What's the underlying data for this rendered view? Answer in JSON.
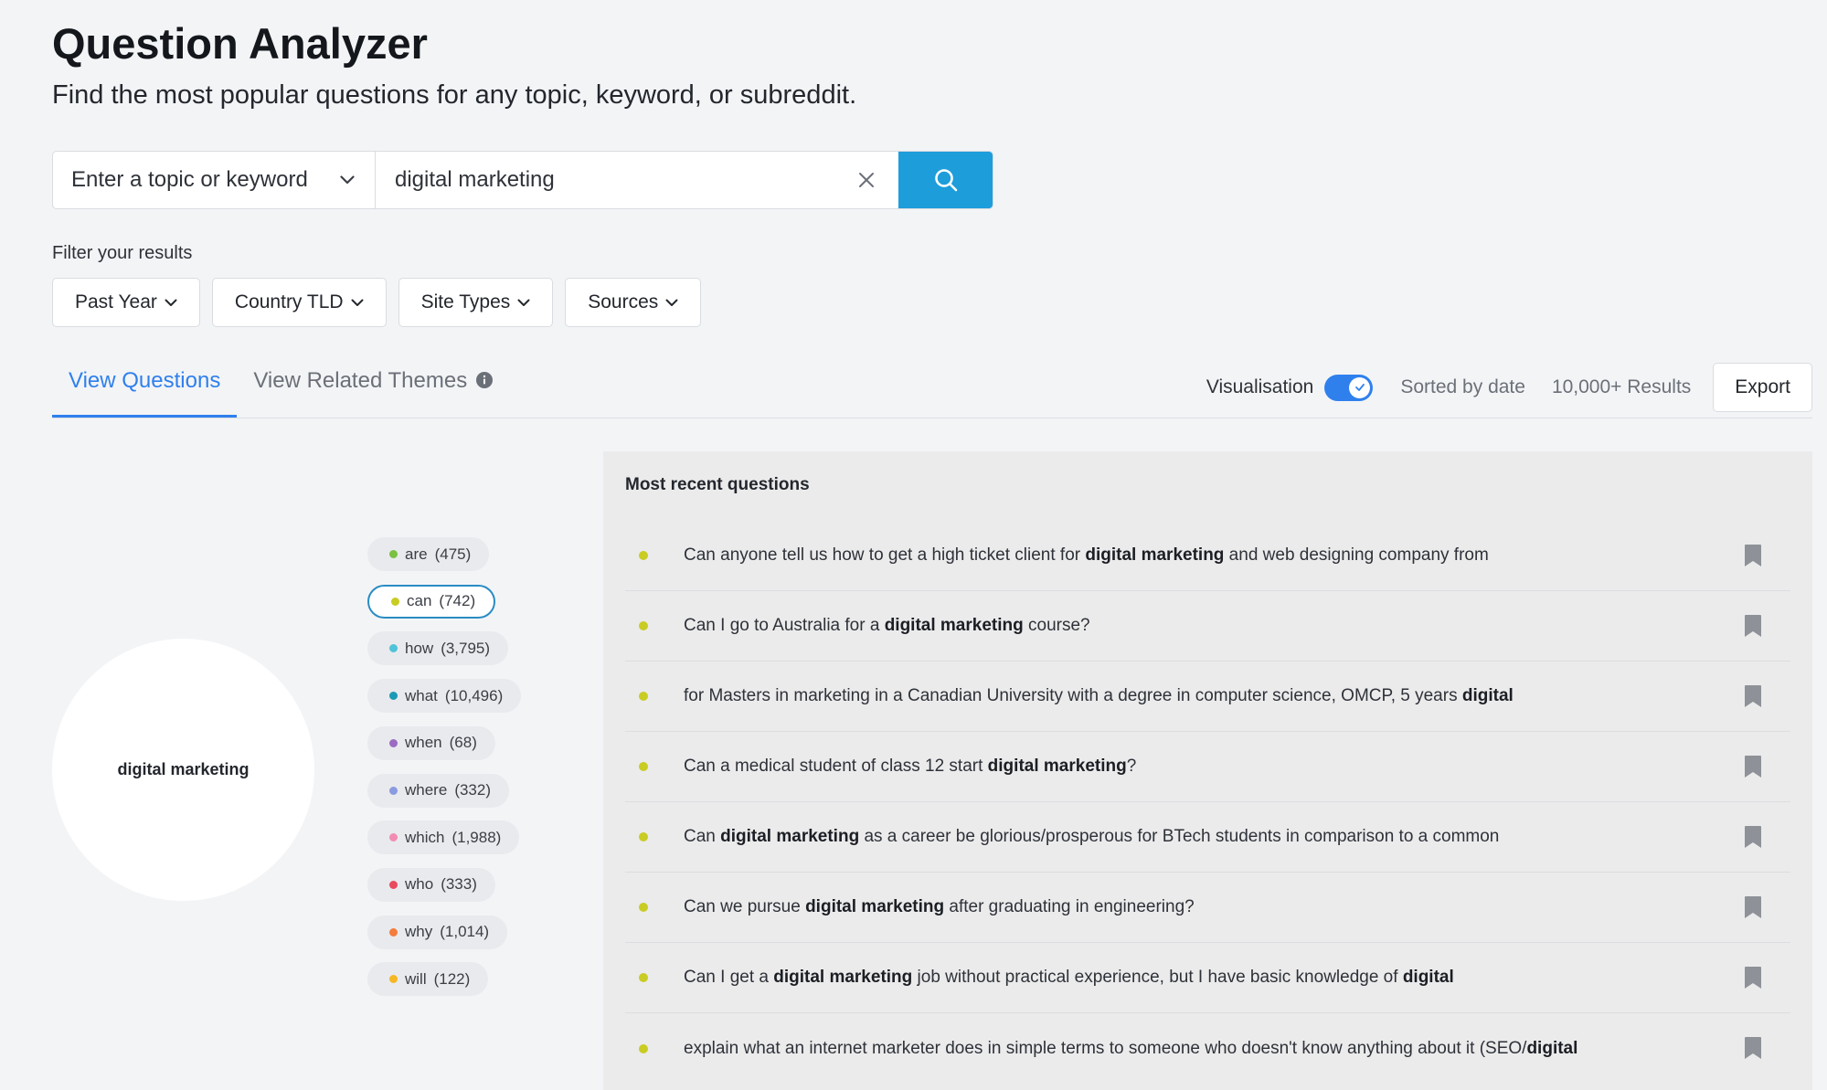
{
  "header": {
    "title": "Question Analyzer",
    "subtitle": "Find the most popular questions for any topic, keyword, or subreddit."
  },
  "search": {
    "topic_select_label": "Enter a topic or keyword",
    "query": "digital marketing"
  },
  "filters": {
    "label": "Filter your results",
    "buttons": [
      "Past Year",
      "Country TLD",
      "Site Types",
      "Sources"
    ]
  },
  "tabs": [
    {
      "label": "View Questions",
      "active": true
    },
    {
      "label": "View Related Themes",
      "active": false
    }
  ],
  "toolbar": {
    "visualisation_label": "Visualisation",
    "visualisation_on": true,
    "sorted_label": "Sorted by date",
    "results_label": "10,000+ Results",
    "export_label": "Export"
  },
  "visualization": {
    "center_label": "digital marketing",
    "chips": [
      {
        "word": "are",
        "count": "(475)",
        "color": "#7ac142",
        "selected": false
      },
      {
        "word": "can",
        "count": "(742)",
        "color": "#c9cc22",
        "selected": true
      },
      {
        "word": "how",
        "count": "(3,795)",
        "color": "#4fc3d9",
        "selected": false
      },
      {
        "word": "what",
        "count": "(10,496)",
        "color": "#1a9bb5",
        "selected": false
      },
      {
        "word": "when",
        "count": "(68)",
        "color": "#9b6cc2",
        "selected": false
      },
      {
        "word": "where",
        "count": "(332)",
        "color": "#8a9be0",
        "selected": false
      },
      {
        "word": "which",
        "count": "(1,988)",
        "color": "#f28cb3",
        "selected": false
      },
      {
        "word": "who",
        "count": "(333)",
        "color": "#e84c5d",
        "selected": false
      },
      {
        "word": "why",
        "count": "(1,014)",
        "color": "#f47c3c",
        "selected": false
      },
      {
        "word": "will",
        "count": "(122)",
        "color": "#f5b824",
        "selected": false
      }
    ]
  },
  "questions": {
    "title": "Most recent questions",
    "dot_color": "#c9cc22",
    "items": [
      [
        {
          "t": "Can anyone tell us how to get a high ticket client for "
        },
        {
          "t": "digital marketing",
          "b": true
        },
        {
          "t": " and web designing company from"
        }
      ],
      [
        {
          "t": "Can I go to Australia for a "
        },
        {
          "t": "digital marketing",
          "b": true
        },
        {
          "t": " course?"
        }
      ],
      [
        {
          "t": "for Masters in marketing in a Canadian University with a degree in computer science, OMCP, 5 years "
        },
        {
          "t": "digital",
          "b": true
        }
      ],
      [
        {
          "t": "Can a medical student of class 12 start "
        },
        {
          "t": "digital marketing",
          "b": true
        },
        {
          "t": "?"
        }
      ],
      [
        {
          "t": "Can "
        },
        {
          "t": "digital marketing",
          "b": true
        },
        {
          "t": " as a career be glorious/prosperous for BTech students in comparison to a common"
        }
      ],
      [
        {
          "t": "Can we pursue "
        },
        {
          "t": "digital marketing",
          "b": true
        },
        {
          "t": " after graduating in engineering?"
        }
      ],
      [
        {
          "t": "Can I get a "
        },
        {
          "t": "digital marketing",
          "b": true
        },
        {
          "t": " job without practical experience, but I have basic knowledge of "
        },
        {
          "t": "digital",
          "b": true
        }
      ],
      [
        {
          "t": "explain what an internet marketer does in simple terms to someone who doesn't know anything about it (SEO/"
        },
        {
          "t": "digital",
          "b": true
        }
      ]
    ]
  }
}
